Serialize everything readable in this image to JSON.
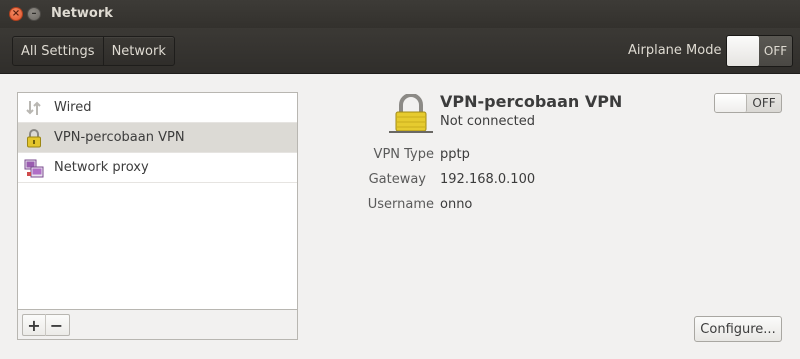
{
  "window": {
    "title": "Network"
  },
  "toolbar": {
    "breadcrumbs": [
      "All Settings",
      "Network"
    ],
    "airplane_mode_label": "Airplane Mode",
    "airplane_mode_state": "OFF"
  },
  "sidebar": {
    "items": [
      {
        "label": "Wired",
        "icon": "network-wired-icon",
        "selected": false
      },
      {
        "label": "VPN-percobaan VPN",
        "icon": "vpn-lock-icon",
        "selected": true
      },
      {
        "label": "Network proxy",
        "icon": "network-proxy-icon",
        "selected": false
      }
    ],
    "add_label": "+",
    "remove_label": "−"
  },
  "detail": {
    "name": "VPN-percobaan VPN",
    "status": "Not connected",
    "switch_state": "OFF",
    "icon": "vpn-lock-icon",
    "fields": [
      {
        "label": "VPN Type",
        "value": "pptp"
      },
      {
        "label": "Gateway",
        "value": "192.168.0.100"
      },
      {
        "label": "Username",
        "value": "onno"
      }
    ],
    "configure_label": "Configure..."
  }
}
